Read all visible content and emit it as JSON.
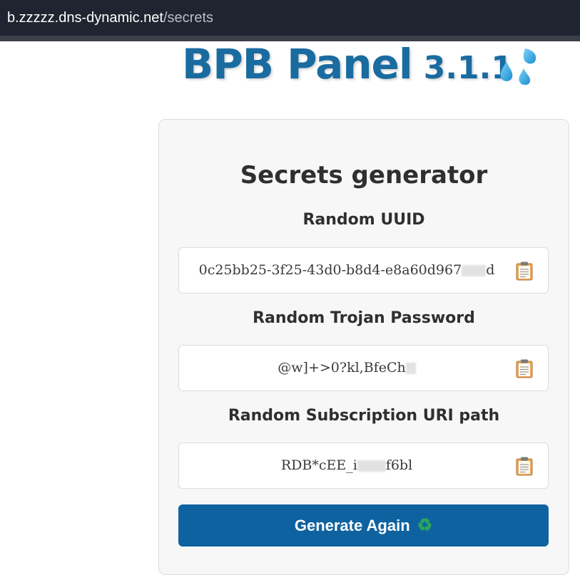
{
  "browser": {
    "url_host": "b.zzzzz.dns-dynamic.net",
    "url_path": "/secrets"
  },
  "header": {
    "title": "BPB Panel",
    "version": "3.1.1",
    "emoji_icon": "sweat-droplets-icon"
  },
  "card": {
    "title": "Secrets generator",
    "sections": [
      {
        "label": "Random UUID",
        "value": "0c25bb25-3f25-43d0-b8d4-e8a60d967",
        "value_tail": "d",
        "copy_icon": "clipboard-icon"
      },
      {
        "label": "Random Trojan Password",
        "value": "@w]+>0?kl,BfeCh",
        "value_tail": "",
        "copy_icon": "clipboard-icon"
      },
      {
        "label": "Random Subscription URI path",
        "value": "RDB*cEE_i",
        "value_tail": "f6bl",
        "copy_icon": "clipboard-icon"
      }
    ],
    "generate_label": "Generate Again",
    "generate_icon": "recycle-icon"
  },
  "colors": {
    "brand_blue": "#1a6ba0",
    "button_blue": "#0f62a0",
    "url_bar_bg": "#1f2530"
  }
}
